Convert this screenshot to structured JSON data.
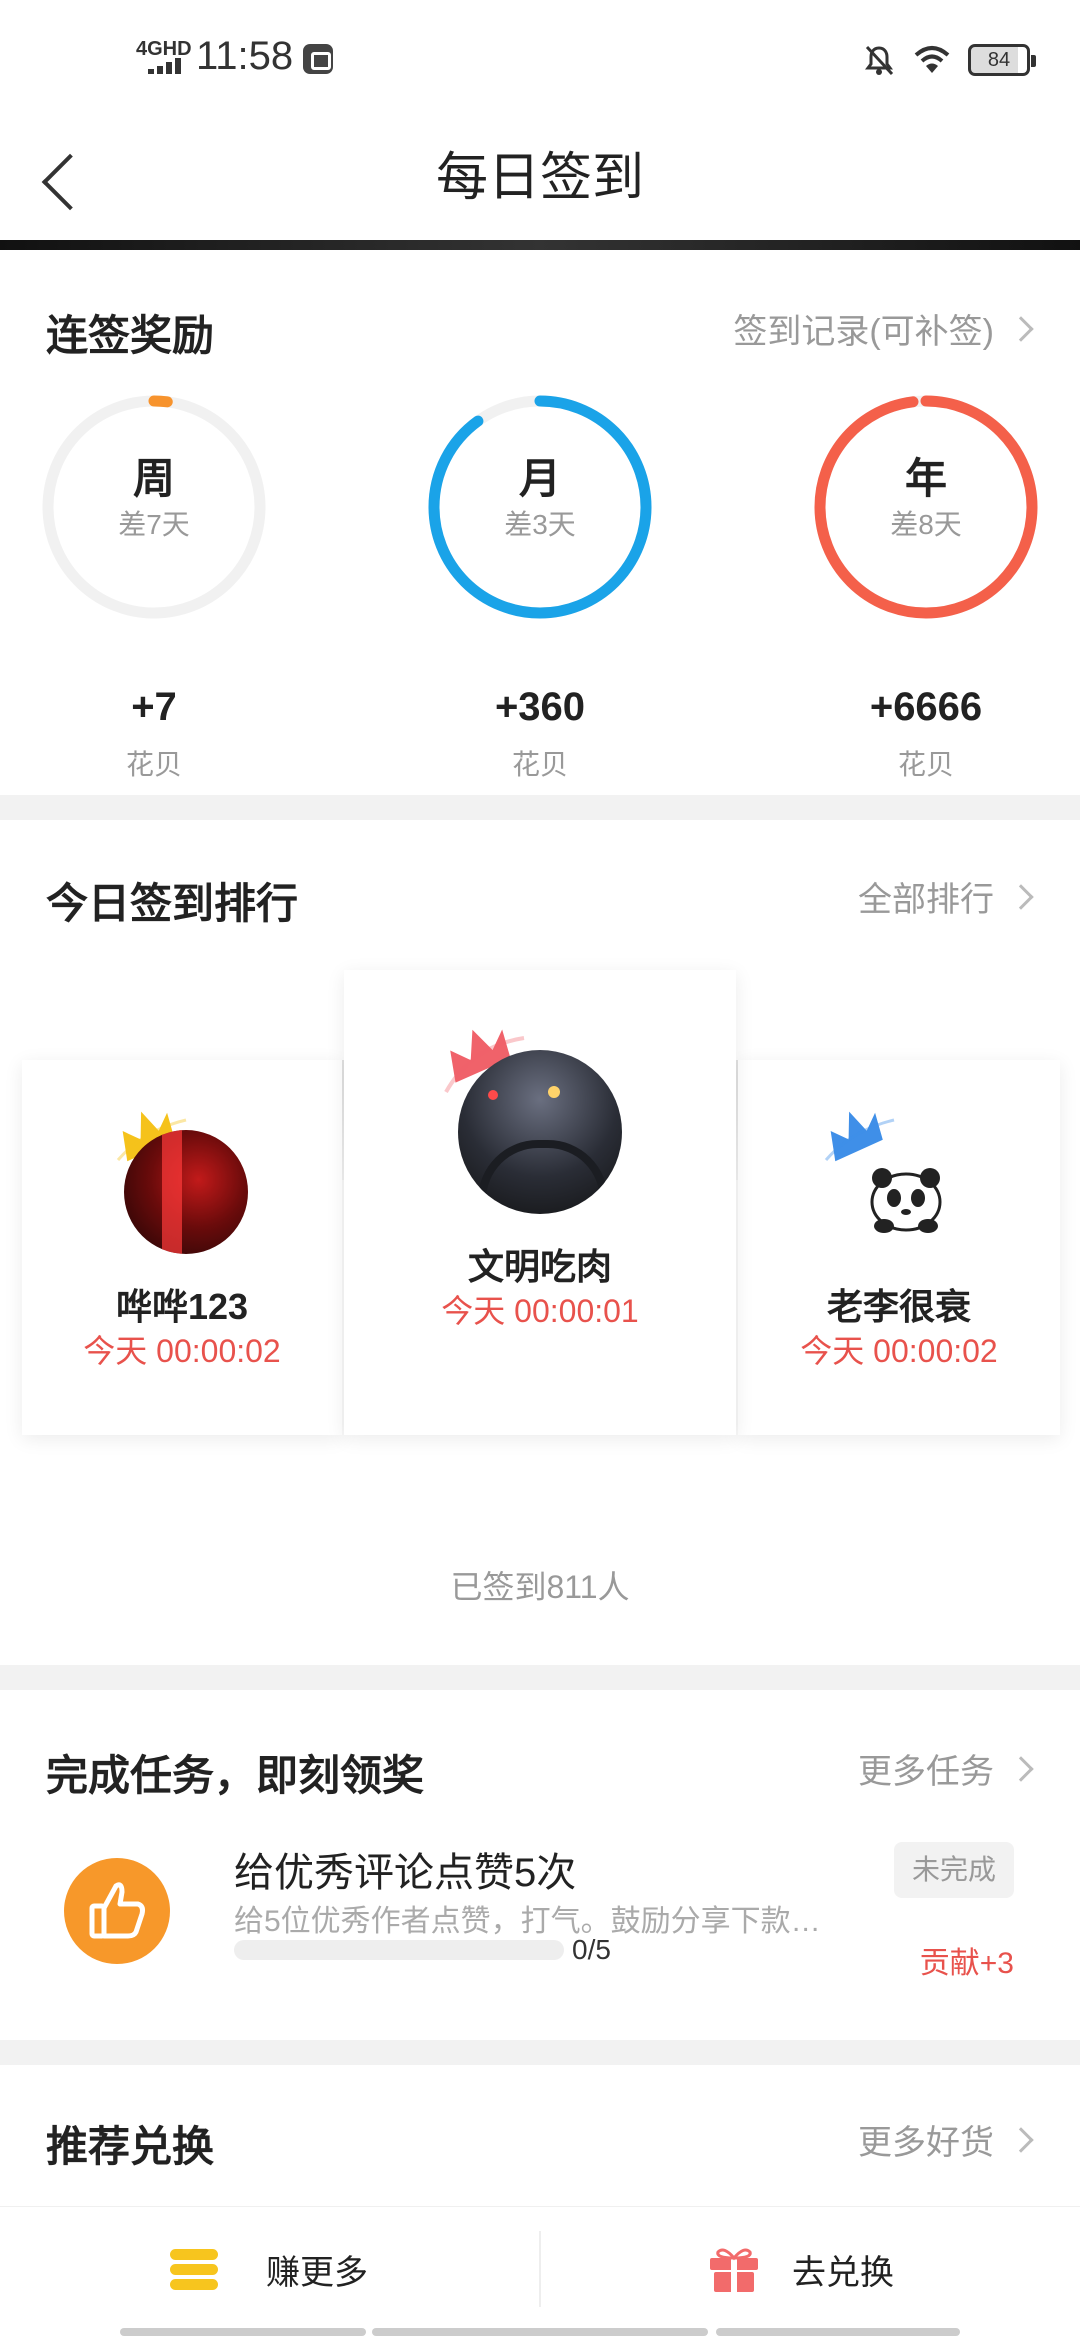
{
  "status_bar": {
    "network": "4GHD",
    "time": "11:58",
    "battery": "84"
  },
  "nav": {
    "title": "每日签到"
  },
  "streak": {
    "title": "连签奖励",
    "link": "签到记录(可补签)",
    "rings": [
      {
        "label": "周",
        "sub": "差7天",
        "value": "+7",
        "unit": "花贝",
        "color": "#f7932d",
        "progress": 0.02
      },
      {
        "label": "月",
        "sub": "差3天",
        "value": "+360",
        "unit": "花贝",
        "color": "#1aa3e8",
        "progress": 0.9
      },
      {
        "label": "年",
        "sub": "差8天",
        "value": "+6666",
        "unit": "花贝",
        "color": "#f4604a",
        "progress": 0.98
      }
    ]
  },
  "ranking": {
    "title": "今日签到排行",
    "link": "全部排行",
    "entries": [
      {
        "name": "文明吃肉",
        "time": "今天 00:00:01",
        "crown_color": "#f0626a"
      },
      {
        "name": "哗哗123",
        "time": "今天 00:00:02",
        "crown_color": "#f5c21b"
      },
      {
        "name": "老李很衰",
        "time": "今天 00:00:02",
        "crown_color": "#3f8fe8"
      }
    ],
    "signed_count": "已签到811人"
  },
  "tasks": {
    "title": "完成任务，即刻领奖",
    "link": "更多任务",
    "items": [
      {
        "icon": "thumbs-up-icon",
        "title": "给优秀评论点赞5次",
        "desc": "给5位优秀作者点赞，打气。鼓励分享下款…",
        "progress": "0/5",
        "status": "未完成",
        "reward": "贡献+3"
      }
    ]
  },
  "exchange": {
    "title": "推荐兑换",
    "link": "更多好货"
  },
  "bottom_bar": {
    "earn_label": "赚更多",
    "exchange_label": "去兑换"
  }
}
